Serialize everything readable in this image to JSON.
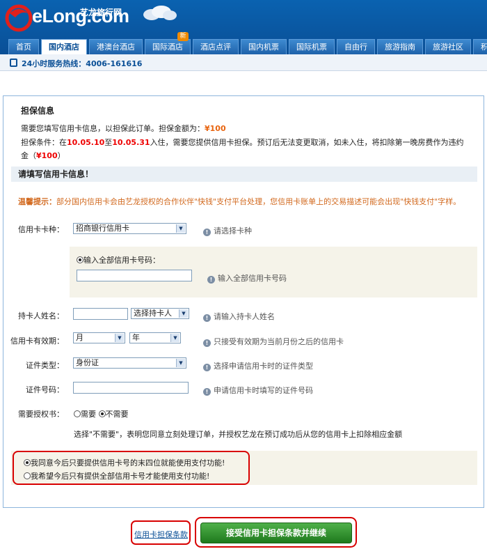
{
  "header": {
    "logo_text": "eLong.com",
    "logo_cn": "艺龙旅行网",
    "nav_tabs": [
      "首页",
      "国内酒店",
      "港澳台酒店",
      "国际酒店",
      "酒店点评",
      "国内机票",
      "国际机票",
      "自由行",
      "旅游指南",
      "旅游社区",
      "积分广"
    ],
    "new_badge": "新",
    "hotline": "24小时服务热线：4006-161616"
  },
  "guarantee": {
    "title": "担保信息",
    "need_fill": "需要您填写信用卡信息，以担保此订单。担保金额为：",
    "amount": "¥100",
    "cond_prefix": "担保条件：在",
    "date_from": "10.05.10",
    "to": "至",
    "date_to": "10.05.31",
    "cond_mid": "入住，需要您提供信用卡担保。预订后无法变更取消，如未入住，将扣除第一晚房费作为违约金",
    "cond_paren_open": "（",
    "cond_paren_close": "）"
  },
  "form": {
    "section_title": "请填写信用卡信息！",
    "tip_label": "温馨提示：",
    "tip_text": "部分国内信用卡会由艺龙授权的合作伙伴\"快钱\"支付平台处理，您信用卡账单上的交易描述可能会出现\"快钱支付\"字样。",
    "card_type_label": "信用卡卡种：",
    "card_type_value": "招商银行信用卡",
    "card_type_hint": "请选择卡种",
    "card_number_option": "输入全部信用卡号码：",
    "card_number_hint": "输入全部信用卡号码",
    "holder_label": "持卡人姓名：",
    "holder_select": "选择持卡人",
    "holder_hint": "请输入持卡人姓名",
    "expiry_label": "信用卡有效期：",
    "month": "月",
    "year": "年",
    "expiry_hint": "只接受有效期为当前月份之后的信用卡",
    "id_type_label": "证件类型：",
    "id_type_value": "身份证",
    "id_type_hint": "选择申请信用卡时的证件类型",
    "id_number_label": "证件号码：",
    "id_number_hint": "申请信用卡时填写的证件号码",
    "auth_label": "需要授权书：",
    "auth_yes": "需要",
    "auth_no": "不需要",
    "auth_note": "选择\"不需要\"，表明您同意立刻处理订单，并授权艺龙在预订成功后从您的信用卡上扣除相应金额"
  },
  "policy": {
    "opt1": "我同意今后只要提供信用卡号的末四位就能使用支付功能!",
    "opt2": "我希望今后只有提供全部信用卡号才能使用支付功能!"
  },
  "actions": {
    "terms_link": "信用卡担保条款",
    "accept_button": "接受信用卡担保条款并继续"
  },
  "colors": {
    "brand_blue": "#0a4f96",
    "accent_orange": "#e8640f",
    "highlight_red": "#d80000",
    "button_green": "#2f8f2c"
  }
}
